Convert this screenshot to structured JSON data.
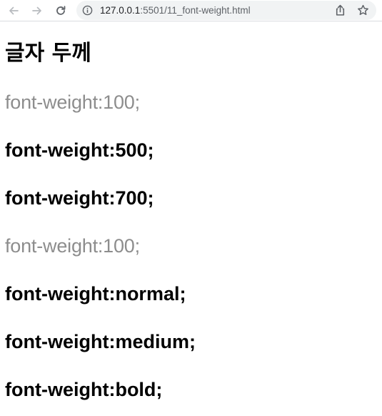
{
  "browser": {
    "url_host": "127.0.0.1",
    "url_rest": ":5501/11_font-weight.html",
    "icons": {
      "back": "back-arrow-icon",
      "forward": "forward-arrow-icon",
      "reload": "reload-icon",
      "info": "info-icon",
      "share": "share-icon",
      "bookmark": "star-icon"
    },
    "colors": {
      "toolbar_bg": "#ffffff",
      "omnibox_bg": "#f1f3f4",
      "icon": "#5f6368"
    }
  },
  "page": {
    "heading": "글자 두께",
    "lines": [
      {
        "text": "font-weight:100;",
        "weight": "thin"
      },
      {
        "text": "font-weight:500;",
        "weight": "bold"
      },
      {
        "text": "font-weight:700;",
        "weight": "bold"
      },
      {
        "text": "font-weight:100;",
        "weight": "thin"
      },
      {
        "text": "font-weight:normal;",
        "weight": "bold"
      },
      {
        "text": "font-weight:medium;",
        "weight": "bold"
      },
      {
        "text": "font-weight:bold;",
        "weight": "bold"
      }
    ]
  }
}
